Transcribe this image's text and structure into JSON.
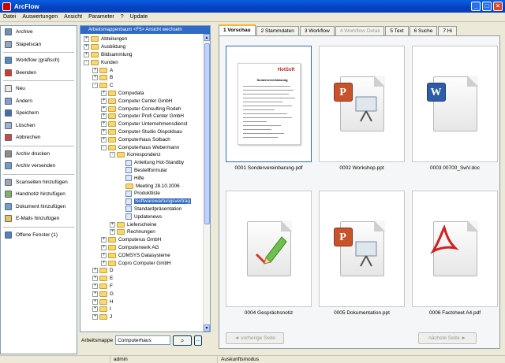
{
  "window": {
    "title": "ArcFlow"
  },
  "menu": [
    "Datei",
    "Auswertungen",
    "Ansicht",
    "Parameter",
    "?",
    "Update"
  ],
  "left_panel": {
    "groups": [
      [
        {
          "label": "Archive",
          "icon": "archive-icon",
          "color": "#6b8fbf"
        },
        {
          "label": "Stapelscan",
          "icon": "scanner-icon",
          "color": "#8ea8cc"
        }
      ],
      [
        {
          "label": "Workflow (grafisch)",
          "icon": "workflow-icon",
          "color": "#4b8bd0"
        },
        {
          "label": "Beenden",
          "icon": "exit-icon",
          "color": "#d23a2a"
        }
      ],
      [
        {
          "label": "Neu",
          "icon": "new-document-icon",
          "color": "#e8e8e8"
        },
        {
          "label": "Ändern",
          "icon": "edit-icon",
          "color": "#7aa0d8"
        },
        {
          "label": "Speichern",
          "icon": "save-icon",
          "color": "#3e6fb5"
        },
        {
          "label": "Löschen",
          "icon": "delete-icon",
          "color": "#9bb3d6"
        },
        {
          "label": "Abbrechen",
          "icon": "cancel-icon",
          "color": "#c74b4b"
        }
      ],
      [
        {
          "label": "Archiv drucken",
          "icon": "print-icon",
          "color": "#8c8c8c"
        },
        {
          "label": "Archiv versenden",
          "icon": "send-icon",
          "color": "#6b9bd8"
        }
      ],
      [
        {
          "label": "Scanseiten hinzufügen",
          "icon": "scan-pages-icon",
          "color": "#9aa7b8"
        },
        {
          "label": "Handnotiz hinzufügen",
          "icon": "handnote-icon",
          "color": "#7fb069"
        },
        {
          "label": "Dokument hinzufügen",
          "icon": "add-document-icon",
          "color": "#6f9ed6"
        },
        {
          "label": "E-Mails hinzufügen",
          "icon": "email-icon",
          "color": "#e7c35a"
        }
      ],
      [
        {
          "label": "Offene Fenster (1)",
          "icon": "windows-icon",
          "color": "#4f7fc4"
        }
      ]
    ]
  },
  "tree": {
    "header": "Arbeitsmappenbaum <F5> Ansicht wechseln",
    "nodes": [
      {
        "label": "Abteilungen",
        "depth": 0,
        "toggle": "+",
        "kind": "folder"
      },
      {
        "label": "Ausbildung",
        "depth": 0,
        "toggle": "+",
        "kind": "folder"
      },
      {
        "label": "Bildsammlung",
        "depth": 0,
        "toggle": "+",
        "kind": "folder"
      },
      {
        "label": "Kunden",
        "depth": 0,
        "toggle": "-",
        "kind": "folder"
      },
      {
        "label": "A",
        "depth": 1,
        "toggle": "+",
        "kind": "folder"
      },
      {
        "label": "B",
        "depth": 1,
        "toggle": "+",
        "kind": "folder"
      },
      {
        "label": "C",
        "depth": 1,
        "toggle": "-",
        "kind": "folder"
      },
      {
        "label": "Compudata",
        "depth": 2,
        "toggle": "+",
        "kind": "folder"
      },
      {
        "label": "Computer Center GmbH",
        "depth": 2,
        "toggle": "+",
        "kind": "folder"
      },
      {
        "label": "Computer Consulting Rodeh",
        "depth": 2,
        "toggle": "+",
        "kind": "folder"
      },
      {
        "label": "Computer Profi Center GmbH",
        "depth": 2,
        "toggle": "+",
        "kind": "folder"
      },
      {
        "label": "Computer Unternehmensdienst",
        "depth": 2,
        "toggle": "+",
        "kind": "folder"
      },
      {
        "label": "Computer-Studio Oispoldsau",
        "depth": 2,
        "toggle": "+",
        "kind": "folder"
      },
      {
        "label": "Computerhaus Solbach",
        "depth": 2,
        "toggle": "+",
        "kind": "folder"
      },
      {
        "label": "Computerhaus Webermann",
        "depth": 2,
        "toggle": "-",
        "kind": "folder"
      },
      {
        "label": "Korrespondenz",
        "depth": 3,
        "toggle": "-",
        "kind": "folder"
      },
      {
        "label": "Anleitung Hot-Standby",
        "depth": 4,
        "toggle": "",
        "kind": "doc"
      },
      {
        "label": "Bestellformular",
        "depth": 4,
        "toggle": "",
        "kind": "doc"
      },
      {
        "label": "Hilfe",
        "depth": 4,
        "toggle": "",
        "kind": "doc"
      },
      {
        "label": "Meeting 28.10.2006",
        "depth": 4,
        "toggle": "",
        "kind": "folder"
      },
      {
        "label": "Produktliste",
        "depth": 4,
        "toggle": "",
        "kind": "doc"
      },
      {
        "label": "Softwarewartungsvertrag",
        "depth": 4,
        "toggle": "",
        "kind": "doc",
        "selected": true
      },
      {
        "label": "Standardpräsentation",
        "depth": 4,
        "toggle": "",
        "kind": "doc"
      },
      {
        "label": "Updatenews",
        "depth": 4,
        "toggle": "",
        "kind": "doc"
      },
      {
        "label": "Lieferscheine",
        "depth": 3,
        "toggle": "+",
        "kind": "folder"
      },
      {
        "label": "Rechnungen",
        "depth": 3,
        "toggle": "+",
        "kind": "folder"
      },
      {
        "label": "Computerus GmbH",
        "depth": 2,
        "toggle": "+",
        "kind": "folder"
      },
      {
        "label": "Computerwerk AG",
        "depth": 2,
        "toggle": "+",
        "kind": "folder"
      },
      {
        "label": "COMSYS Datasysteme",
        "depth": 2,
        "toggle": "+",
        "kind": "folder"
      },
      {
        "label": "Copro Computer GmbH",
        "depth": 2,
        "toggle": "+",
        "kind": "folder"
      },
      {
        "label": "D",
        "depth": 1,
        "toggle": "+",
        "kind": "folder"
      },
      {
        "label": "E",
        "depth": 1,
        "toggle": "+",
        "kind": "folder"
      },
      {
        "label": "F",
        "depth": 1,
        "toggle": "+",
        "kind": "folder"
      },
      {
        "label": "G",
        "depth": 1,
        "toggle": "+",
        "kind": "folder"
      },
      {
        "label": "H",
        "depth": 1,
        "toggle": "+",
        "kind": "folder"
      },
      {
        "label": "I",
        "depth": 1,
        "toggle": "+",
        "kind": "folder"
      },
      {
        "label": "J",
        "depth": 1,
        "toggle": "+",
        "kind": "folder"
      }
    ]
  },
  "search": {
    "label": "Arbeitsmappe",
    "value": "Computerhaus"
  },
  "tabs": [
    {
      "label": "1 Vorschau",
      "state": "active"
    },
    {
      "label": "2 Stammdaten",
      "state": "normal"
    },
    {
      "label": "3 Workflow",
      "state": "normal"
    },
    {
      "label": "4 Workflow Detail",
      "state": "disabled"
    },
    {
      "label": "5 Text",
      "state": "normal"
    },
    {
      "label": "6 Suche",
      "state": "normal"
    },
    {
      "label": "7 Hi",
      "state": "normal"
    }
  ],
  "documents": [
    {
      "caption": "0001 Sondervereinbarung.pdf",
      "type": "page-preview"
    },
    {
      "caption": "0002 Workshop.ppt",
      "type": "ppt"
    },
    {
      "caption": "0003 00700_SwV.doc",
      "type": "doc"
    },
    {
      "caption": "0004 Gesprächsnotiz",
      "type": "note"
    },
    {
      "caption": "0005 Dokumentation.ppt",
      "type": "ppt"
    },
    {
      "caption": "0006 Factsheet A4.pdf",
      "type": "pdf"
    }
  ],
  "preview_doc": {
    "logo": "HotSoft",
    "heading": "Sondervereinbarung"
  },
  "nav": {
    "prev": "vorherige Seite",
    "next": "nächste Seite"
  },
  "status": {
    "user": "admin",
    "mode": "Auskunftsmodus"
  }
}
